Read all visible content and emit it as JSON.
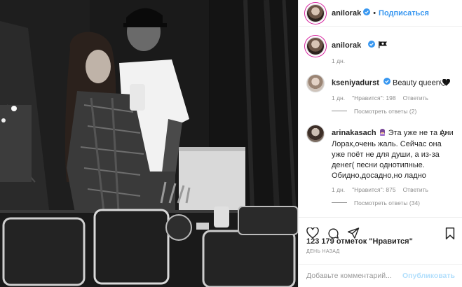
{
  "post": {
    "author": "anilorak",
    "follow_label": "Подписаться",
    "dot": "•",
    "caption_time": "1 дн.",
    "likes_count": "123 179",
    "likes_suffix": "отметок \"Нравится\"",
    "posted_ago": "День назад"
  },
  "comments": [
    {
      "user": "kseniyadurst",
      "text": "Beauty queen",
      "time": "1 дн.",
      "likes": "\"Нравится\": 198",
      "reply_label": "Ответить",
      "view_replies": "Посмотреть ответы (2)"
    },
    {
      "user": "arinakasach",
      "text": "Эта уже не та Ани Лорак,очень жаль. Сейчас она уже поёт не для души, а из-за денег( песни однотипные. Обидно,досадно,но ладно",
      "time": "1 дн.",
      "likes": "\"Нравится\": 875",
      "reply_label": "Ответить",
      "view_replies": "Посмотреть ответы (34)"
    }
  ],
  "comment_box": {
    "placeholder": "Добавьте комментарий...",
    "publish_label": "Опубликовать"
  },
  "icons": {
    "like": "heart-icon",
    "comment": "comment-icon",
    "share": "share-icon",
    "save": "bookmark-icon",
    "verified": "verified-badge-icon",
    "caption_emoji": "pirate-flag-emoji"
  },
  "colors": {
    "link": "#3897f0",
    "verified": "#3897f0",
    "muted": "#8e8e8e",
    "publish_disabled": "#b2dffc"
  }
}
